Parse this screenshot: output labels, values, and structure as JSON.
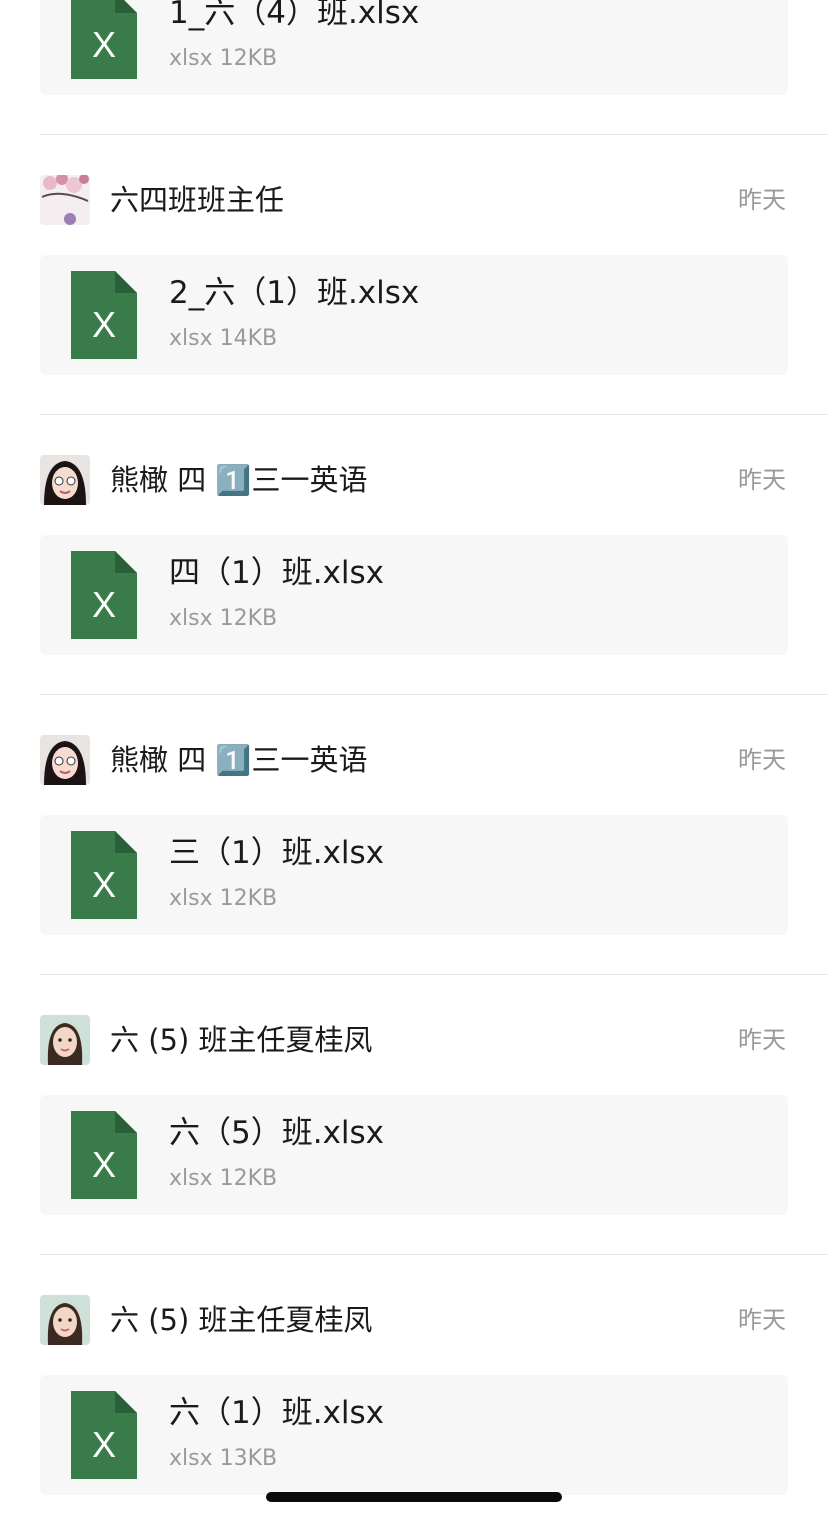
{
  "colors": {
    "excel_green": "#3a7b4a",
    "card_bg": "#f7f7f7",
    "meta_gray": "#9a9a9a"
  },
  "entries": [
    {
      "sender": "",
      "time": "",
      "file": {
        "name": "1_六（4）班.xlsx",
        "meta": "xlsx 12KB",
        "icon": "excel-file-icon"
      }
    },
    {
      "sender": "六四班班主任",
      "time": "昨天",
      "avatar": "blossom-photo",
      "file": {
        "name": "2_六（1）班.xlsx",
        "meta": "xlsx 14KB",
        "icon": "excel-file-icon"
      }
    },
    {
      "sender": "熊橄 四 1️⃣三一英语",
      "time": "昨天",
      "avatar": "girl-photo",
      "file": {
        "name": "四（1）班.xlsx",
        "meta": "xlsx 12KB",
        "icon": "excel-file-icon"
      }
    },
    {
      "sender": "熊橄 四 1️⃣三一英语",
      "time": "昨天",
      "avatar": "girl-photo",
      "file": {
        "name": "三（1）班.xlsx",
        "meta": "xlsx 12KB",
        "icon": "excel-file-icon"
      }
    },
    {
      "sender": "六 (5) 班主任夏桂凤",
      "time": "昨天",
      "avatar": "woman-photo",
      "file": {
        "name": "六（5）班.xlsx",
        "meta": "xlsx 12KB",
        "icon": "excel-file-icon"
      }
    },
    {
      "sender": "六 (5) 班主任夏桂凤",
      "time": "昨天",
      "avatar": "woman-photo",
      "file": {
        "name": "六（1）班.xlsx",
        "meta": "xlsx 13KB",
        "icon": "excel-file-icon"
      }
    }
  ]
}
